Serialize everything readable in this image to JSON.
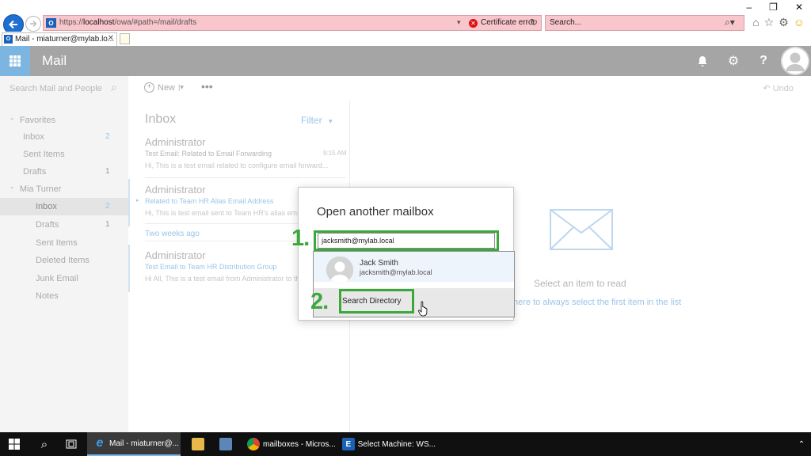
{
  "browser": {
    "address_url_prefix": "https://",
    "address_url_host": "localhost",
    "address_url_path": "/owa/#path=/mail/drafts",
    "cert_error": "Certificate error",
    "search_placeholder": "Search...",
    "tab_title": "Mail - miaturner@mylab.lo...",
    "window_controls": [
      "–",
      "❐",
      "✕"
    ]
  },
  "suite": {
    "app_name": "Mail",
    "colors": {
      "bar": "#a5a5a5",
      "waffle": "#7bb5e0"
    },
    "icons": [
      "bell-icon",
      "gear-icon",
      "help-icon",
      "avatar"
    ]
  },
  "commands": {
    "search_placeholder": "Search Mail and People",
    "new_label": "New",
    "more_label": "•••",
    "undo_label": "Undo"
  },
  "folders": {
    "favorites_label": "Favorites",
    "favorites": [
      {
        "label": "Inbox",
        "count": "2"
      },
      {
        "label": "Sent Items",
        "count": ""
      },
      {
        "label": "Drafts",
        "count": "1"
      }
    ],
    "account_label": "Mia Turner",
    "account": [
      {
        "label": "Inbox",
        "count": "2"
      },
      {
        "label": "Drafts",
        "count": "1"
      },
      {
        "label": "Sent Items",
        "count": ""
      },
      {
        "label": "Deleted Items",
        "count": ""
      },
      {
        "label": "Junk Email",
        "count": ""
      },
      {
        "label": "Notes",
        "count": ""
      }
    ]
  },
  "messages": {
    "title": "Inbox",
    "filter_label": "Filter",
    "group_label": "Two weeks ago",
    "items": [
      {
        "from": "Administrator",
        "subject": "Test Email: Related to Email Forwarding",
        "preview": "Hi, This is a test email related to configure email forward...",
        "time": "9:15 AM"
      },
      {
        "from": "Administrator",
        "subject": "Related to Team HR Alias Email Address",
        "preview": "Hi, This is test email sent to Team HR's alias email",
        "time": ""
      },
      {
        "from": "Administrator",
        "subject": "Test Email to Team HR Distribution Group",
        "preview": "Hi All, This is a test email from Administrator to the",
        "time": ""
      }
    ]
  },
  "reading": {
    "empty_message": "Select an item to read",
    "link_text": "here to always select the first item in the list"
  },
  "dialog": {
    "title": "Open another mailbox",
    "input_value": "jacksmith@mylab.local",
    "suggestion_name": "Jack Smith",
    "suggestion_email": "jacksmith@mylab.local",
    "search_directory_label": "Search Directory",
    "step1_label": "1.",
    "step2_label": "2.",
    "highlight_color": "#3ca83b"
  },
  "taskbar": {
    "items": [
      {
        "label": "Mail - miaturner@..."
      },
      {
        "label": "mailboxes - Micros..."
      },
      {
        "label": "Select Machine: WS..."
      }
    ]
  }
}
